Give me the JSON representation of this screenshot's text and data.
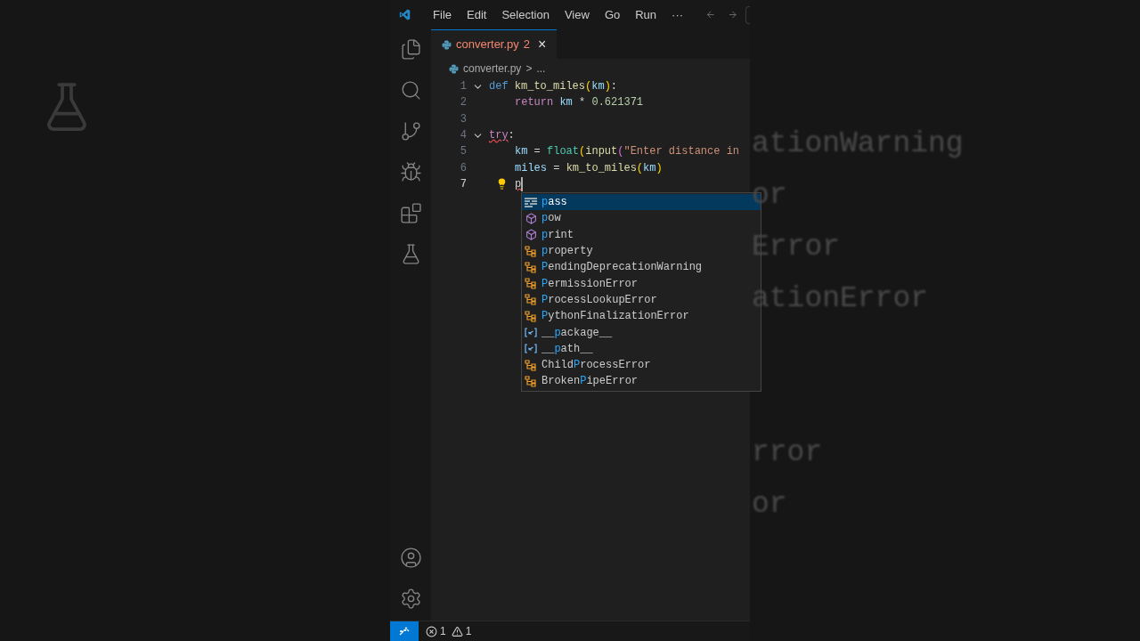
{
  "backdrop": {
    "right_fragments": [
      "ationWarning",
      "or",
      "Error",
      "ationError",
      "rror",
      "or"
    ]
  },
  "menu": [
    "File",
    "Edit",
    "Selection",
    "View",
    "Go",
    "Run",
    "···"
  ],
  "tab": {
    "filename": "converter.py",
    "problems": "2",
    "close": "×",
    "selected": true
  },
  "breadcrumb": {
    "file": "converter.py",
    "separator": ">",
    "rest": "..."
  },
  "lines": [
    {
      "number": "1",
      "expanded": true,
      "tokens": [
        {
          "text": "def ",
          "kind": "keyword",
          "squiggle": false
        },
        {
          "text": "km_to_miles",
          "kind": "function",
          "squiggle": false
        },
        {
          "text": "(",
          "kind": "bracket",
          "squiggle": false
        },
        {
          "text": "km",
          "kind": "variable",
          "squiggle": false
        },
        {
          "text": ")",
          "kind": "bracket",
          "squiggle": false
        },
        {
          "text": ":",
          "kind": "plain",
          "squiggle": false
        }
      ],
      "children": [
        {
          "number": "2",
          "current": false,
          "lightbulb": false,
          "cursor": false,
          "tokens": [
            {
              "text": "return ",
              "kind": "control",
              "squiggle": false
            },
            {
              "text": "km",
              "kind": "variable",
              "squiggle": false
            },
            {
              "text": " * ",
              "kind": "plain",
              "squiggle": false
            },
            {
              "text": "0.621371",
              "kind": "number",
              "squiggle": false
            }
          ]
        }
      ]
    },
    {
      "number": "3"
    },
    {
      "number": "4",
      "expanded": true,
      "tokens": [
        {
          "text": "try",
          "kind": "control",
          "squiggle": true
        },
        {
          "text": ":",
          "kind": "plain",
          "squiggle": false
        }
      ],
      "children": [
        {
          "number": "5",
          "current": false,
          "lightbulb": false,
          "cursor": false,
          "tokens": [
            {
              "text": "km",
              "kind": "variable",
              "squiggle": false
            },
            {
              "text": " = ",
              "kind": "plain",
              "squiggle": false
            },
            {
              "text": "float",
              "kind": "class",
              "squiggle": false
            },
            {
              "text": "(",
              "kind": "bracket",
              "squiggle": false
            },
            {
              "text": "input",
              "kind": "function",
              "squiggle": false
            },
            {
              "text": "(",
              "kind": "bracket2",
              "squiggle": false
            },
            {
              "text": "\"Enter distance in",
              "kind": "string",
              "squiggle": false
            }
          ]
        },
        {
          "number": "6",
          "current": false,
          "lightbulb": false,
          "cursor": false,
          "tokens": [
            {
              "text": "miles",
              "kind": "variable",
              "squiggle": false
            },
            {
              "text": " = ",
              "kind": "plain",
              "squiggle": false
            },
            {
              "text": "km_to_miles",
              "kind": "function",
              "squiggle": false
            },
            {
              "text": "(",
              "kind": "bracket",
              "squiggle": false
            },
            {
              "text": "km",
              "kind": "variable",
              "squiggle": false
            },
            {
              "text": ")",
              "kind": "bracket",
              "squiggle": false
            }
          ]
        },
        {
          "number": "7",
          "current": true,
          "lightbulb": true,
          "cursor": true,
          "tokens": [
            {
              "text": "p",
              "kind": "plain",
              "squiggle": true
            }
          ]
        }
      ]
    }
  ],
  "suggestions": [
    {
      "kind": "keyword",
      "match": "p",
      "after": "ass",
      "selected": true
    },
    {
      "kind": "function",
      "match": "p",
      "after": "ow",
      "selected": false
    },
    {
      "kind": "function",
      "match": "p",
      "after": "rint",
      "selected": false
    },
    {
      "kind": "class",
      "match": "p",
      "after": "roperty",
      "selected": false
    },
    {
      "kind": "class",
      "match": "P",
      "after": "endingDeprecationWarning",
      "selected": false
    },
    {
      "kind": "class",
      "match": "P",
      "after": "ermissionError",
      "selected": false
    },
    {
      "kind": "class",
      "match": "P",
      "after": "rocessLookupError",
      "selected": false
    },
    {
      "kind": "class",
      "match": "P",
      "after": "ythonFinalizationError",
      "selected": false
    },
    {
      "kind": "variable",
      "before": "__",
      "match": "p",
      "after": "ackage__",
      "selected": false
    },
    {
      "kind": "variable",
      "before": "__",
      "match": "p",
      "after": "ath__",
      "selected": false
    },
    {
      "kind": "class",
      "before": "Child",
      "match": "P",
      "after": "rocessError",
      "selected": false
    },
    {
      "kind": "class",
      "before": "Broken",
      "match": "P",
      "after": "ipeError",
      "selected": false
    }
  ],
  "status_bar": {
    "errors": "1",
    "warnings": "1"
  }
}
